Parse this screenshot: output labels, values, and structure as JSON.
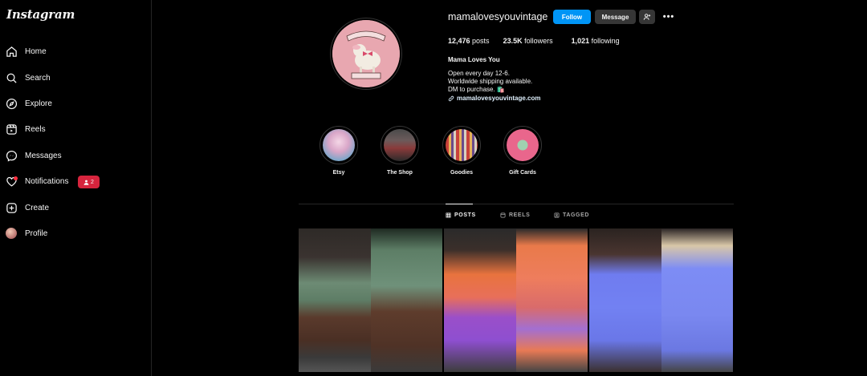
{
  "app": {
    "logo": "Instagram"
  },
  "sidebar": {
    "items": [
      {
        "label": "Home",
        "icon": "home-icon"
      },
      {
        "label": "Search",
        "icon": "search-icon"
      },
      {
        "label": "Explore",
        "icon": "compass-icon"
      },
      {
        "label": "Reels",
        "icon": "reels-icon"
      },
      {
        "label": "Messages",
        "icon": "messenger-icon"
      },
      {
        "label": "Notifications",
        "icon": "heart-icon"
      },
      {
        "label": "Create",
        "icon": "plus-square-icon"
      },
      {
        "label": "Profile",
        "icon": "avatar-icon"
      }
    ],
    "notification_badge": "2"
  },
  "profile": {
    "username": "mamalovesyouvintage",
    "follow_label": "Follow",
    "message_label": "Message",
    "posts_count": "12,476",
    "posts_label": "posts",
    "followers_count": "23.5K",
    "followers_label": "followers",
    "following_count": "1,021",
    "following_label": "following",
    "full_name": "Mama Loves You",
    "bio_line1": "Open every day 12-6.",
    "bio_line2": "Worldwide shipping available.",
    "bio_line3": "DM to purchase. 🛍️",
    "link": "mamalovesyouvintage.com",
    "avatar_text_top": "MAMA LOVES YOU",
    "avatar_text_bottom": "VINTAGE"
  },
  "highlights": [
    {
      "label": "Etsy"
    },
    {
      "label": "The Shop"
    },
    {
      "label": "Goodies"
    },
    {
      "label": "Gift Cards"
    }
  ],
  "tabs": [
    {
      "label": "POSTS",
      "active": true
    },
    {
      "label": "REELS",
      "active": false
    },
    {
      "label": "TAGGED",
      "active": false
    }
  ],
  "colors": {
    "accent": "#0095f6",
    "badge": "#d6243d",
    "avatar_bg": "#e8a7b0"
  }
}
